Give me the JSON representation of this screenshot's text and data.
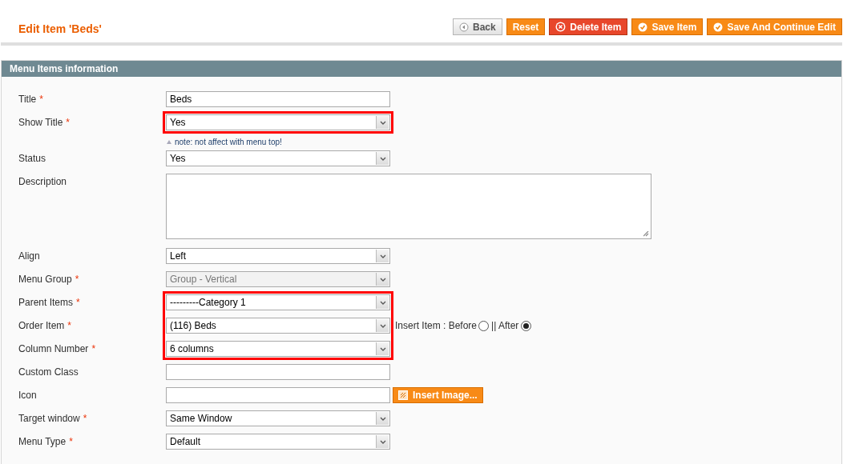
{
  "page_title": "Edit Item 'Beds'",
  "buttons": [
    {
      "label": "Back",
      "kind": "back"
    },
    {
      "label": "Reset",
      "kind": "plain"
    },
    {
      "label": "Delete Item",
      "kind": "delete"
    },
    {
      "label": "Save Item",
      "kind": "save"
    },
    {
      "label": "Save And Continue Edit",
      "kind": "save"
    }
  ],
  "section_title": "Menu Items information",
  "fields": [
    {
      "label": "Title",
      "required_mark": "*",
      "kind": "text",
      "value": "Beds",
      "highlighted": false
    },
    {
      "label": "Show Title",
      "required_mark": "*",
      "kind": "select",
      "value": "Yes",
      "highlighted": true,
      "note": "note: not affect with menu top!"
    },
    {
      "label": "Status",
      "kind": "select",
      "value": "Yes",
      "highlighted": false
    },
    {
      "label": "Description",
      "kind": "textarea",
      "highlighted": false
    },
    {
      "label": "Align",
      "kind": "select",
      "value": "Left",
      "highlighted": false
    },
    {
      "label": "Menu Group",
      "required_mark": "*",
      "kind": "select",
      "value": "Group - Vertical",
      "disabled": true,
      "highlighted": false
    },
    {
      "label": "Parent Items",
      "required_mark": "*",
      "kind": "select",
      "value": "---------Category 1",
      "highlighted": true
    },
    {
      "label": "Order Item",
      "required_mark": "*",
      "kind": "select",
      "value": "(116) Beds",
      "highlighted": true,
      "insert": {
        "label": "Insert Item : Before",
        "separator": "|| After",
        "options": [
          {
            "selected": false
          },
          {
            "selected": true
          }
        ]
      }
    },
    {
      "label": "Column Number",
      "required_mark": "*",
      "kind": "select",
      "value": "6 columns",
      "highlighted": true
    },
    {
      "label": "Custom Class",
      "kind": "text",
      "highlighted": false
    },
    {
      "label": "Icon",
      "kind": "image",
      "highlighted": false,
      "button": "Insert Image..."
    },
    {
      "label": "Target window",
      "required_mark": "*",
      "kind": "select",
      "value": "Same Window",
      "highlighted": false
    },
    {
      "label": "Menu Type",
      "required_mark": "*",
      "kind": "select",
      "value": "Default",
      "highlighted": false
    }
  ]
}
